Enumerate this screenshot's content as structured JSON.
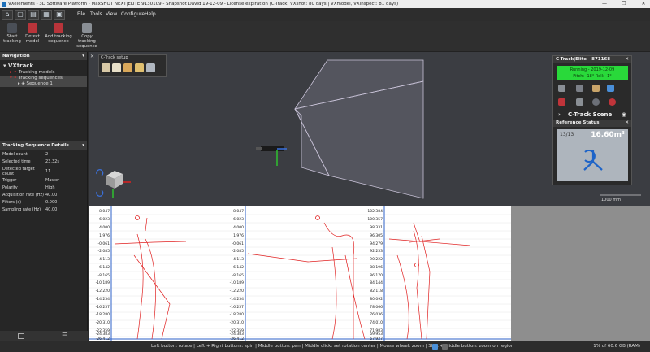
{
  "window": {
    "title": "VXelements - 3D Software Platform - MaxSHOT NEXT|ELITE 9130109 - Snapshot David 19-12-09 - License expiration (C-Track, VXshot: 80 days | VXmodel, VXinspect: 81 days)",
    "minimize": "—",
    "maximize": "❐",
    "close": "✕"
  },
  "menu": {
    "items": [
      "File",
      "Tools",
      "View",
      "Configure",
      "Help"
    ],
    "quick": [
      "⌂",
      "▢",
      "▤",
      "▦",
      "▣"
    ]
  },
  "toolbar": {
    "start_tracking": "Start tracking",
    "detect_model": "Detect model",
    "add_sequence": "Add tracking sequence",
    "copy_sequence": "Copy tracking sequence"
  },
  "navigation": {
    "header": "Navigation",
    "collapse": "▾",
    "tree": [
      {
        "label": "VXtrack",
        "level": 0
      },
      {
        "label": "Tracking models",
        "level": 1
      },
      {
        "label": "Tracking sequences",
        "level": 1
      },
      {
        "label": "Sequence 1",
        "level": 2
      }
    ]
  },
  "details": {
    "header": "Tracking Sequence Details",
    "collapse": "▾",
    "rows": [
      {
        "k": "Model count",
        "v": "2"
      },
      {
        "k": "Selected time",
        "v": "23.32s"
      },
      {
        "k": "Detected target count",
        "v": "11"
      },
      {
        "k": "Trigger",
        "v": "Master"
      },
      {
        "k": "Polarity",
        "v": "High"
      },
      {
        "k": "Acquisition rate (Hz)",
        "v": "40.00"
      },
      {
        "k": "Filters (s)",
        "v": "0.000"
      },
      {
        "k": "Sampling rate (Hz)",
        "v": "40.00"
      }
    ]
  },
  "viewport": {
    "close": "✕",
    "ctrack_title": "C-Track setup",
    "scale_label": "1000 mm"
  },
  "ctrack_panel": {
    "header": "C-Track|Elite - 871168",
    "status_line1": "Running - 2019-12-09",
    "status_line2": "Pitch: -18° Roll: -1°",
    "scene_label": "C-Track Scene",
    "close": "✕",
    "expand": "›",
    "eye": "◉"
  },
  "reference": {
    "header": "Reference Status",
    "count": "13/13",
    "volume": "16.60m³",
    "close": "✕"
  },
  "graphs": [
    {
      "ticks": [
        "8.047",
        "6.023",
        "4.000",
        "1.976",
        "-0.061",
        "-2.085",
        "-4.113",
        "-6.142",
        "-8.165",
        "-10.189",
        "-12.220",
        "-14.234",
        "-16.257",
        "-18.280",
        "-20.310",
        "-22.359",
        "-24.383",
        "-26.412"
      ]
    },
    {
      "ticks": [
        "8.047",
        "6.023",
        "4.000",
        "1.976",
        "-0.061",
        "-2.085",
        "-4.113",
        "-6.142",
        "-8.165",
        "-10.189",
        "-12.220",
        "-14.234",
        "-16.257",
        "-18.280",
        "-20.310",
        "-22.359",
        "-24.383",
        "-26.412"
      ]
    },
    {
      "ticks": [
        "102.384",
        "100.357",
        "98.331",
        "96.305",
        "94.279",
        "92.253",
        "90.222",
        "88.196",
        "86.170",
        "84.144",
        "82.118",
        "80.092",
        "78.066",
        "76.036",
        "74.010",
        "71.983",
        "69.953",
        "67.927"
      ]
    }
  ],
  "status": {
    "message": "Left button: rotate | Left + Right buttons: spin | Middle button: pan | Middle click: set rotation center | Mouse wheel: zoom | Shift + Middle button: zoom on region",
    "ram": "1% of 60.6 GB (RAM)"
  },
  "colors": {
    "accent": "#29d93a",
    "curve": "#e02020",
    "panel": "#262626"
  }
}
